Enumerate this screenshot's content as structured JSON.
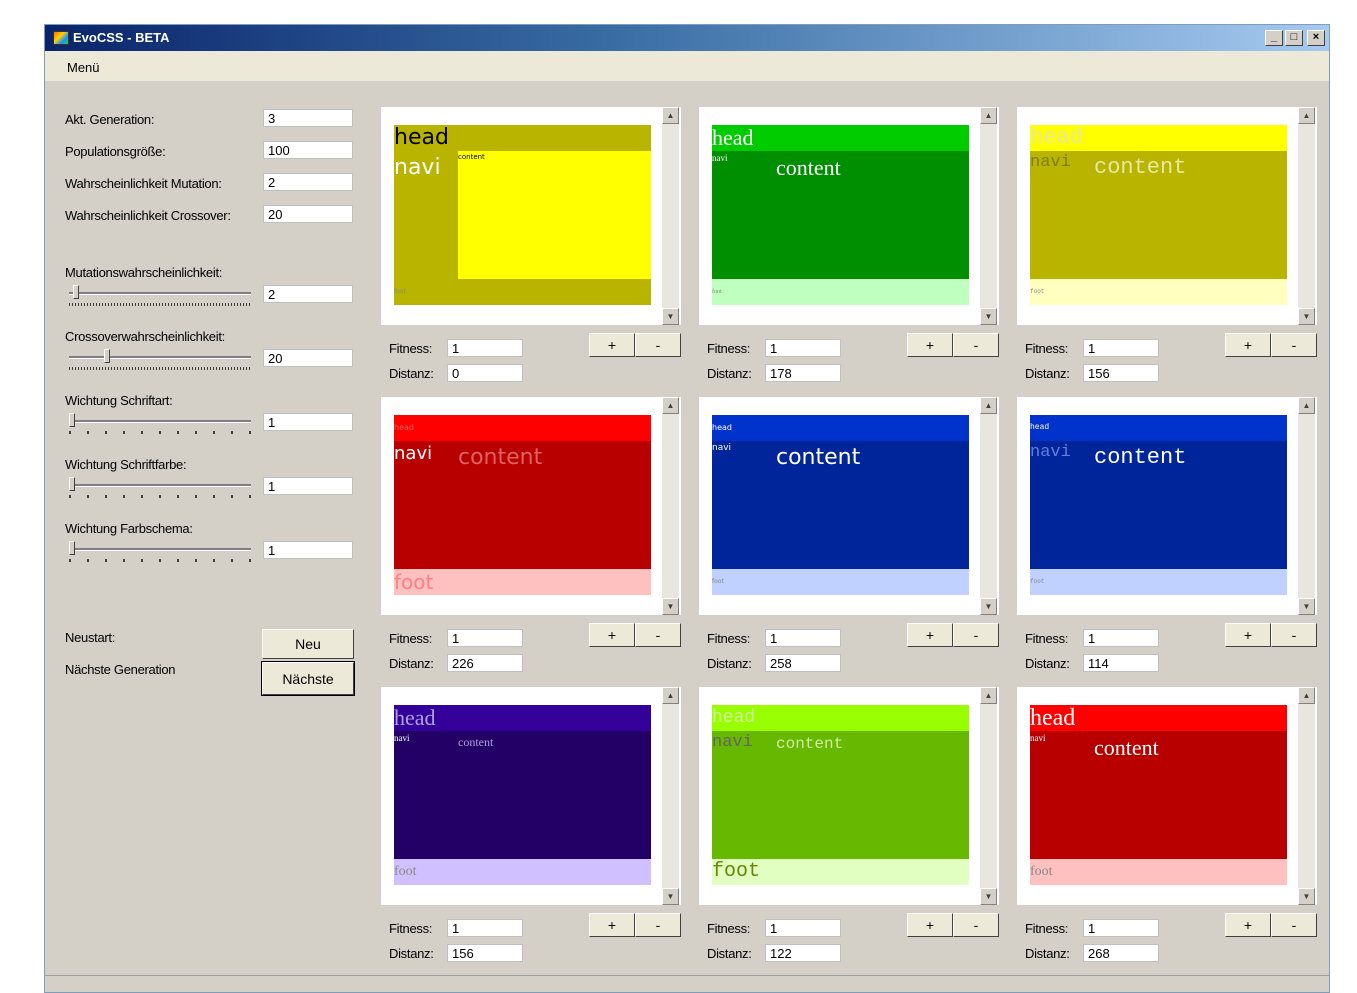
{
  "window": {
    "title": "EvoCSS - BETA",
    "controls": [
      "_",
      "□",
      "×"
    ]
  },
  "menu": {
    "items": [
      "Menü"
    ]
  },
  "left": {
    "fields": [
      {
        "label": "Akt. Generation:",
        "value": "3"
      },
      {
        "label": "Populationsgröße:",
        "value": "100"
      },
      {
        "label": "Wahrscheinlichkeit Mutation:",
        "value": "2"
      },
      {
        "label": "Wahrscheinlichkeit Crossover:",
        "value": "20"
      }
    ],
    "sliders": [
      {
        "label": "Mutationswahrscheinlichkeit:",
        "value": "2",
        "level": 0.02
      },
      {
        "label": "Crossoverwahrscheinlichkeit:",
        "value": "20",
        "level": 0.2
      },
      {
        "label": "Wichtung Schriftart:",
        "value": "1",
        "level": 0
      },
      {
        "label": "Wichtung Schriftfarbe:",
        "value": "1",
        "level": 0
      },
      {
        "label": "Wichtung Farbschema:",
        "value": "1",
        "level": 0
      }
    ],
    "neustart_label": "Neustart:",
    "next_label": "Nächste Generation",
    "neu_button": "Neu",
    "next_button": "Nächste"
  },
  "metric_labels": {
    "fitness": "Fitness:",
    "distance": "Distanz:"
  },
  "vote_buttons": {
    "plus": "+",
    "minus": "-"
  },
  "scroll_arrows": {
    "up": "▲",
    "down": "▼"
  },
  "individuals": [
    {
      "fitness": "1",
      "distance": "0",
      "colors": {
        "head": "#b8b400",
        "main": "#b8b400",
        "foot": "#b8b400",
        "inset": "#ffff00",
        "text": "#000000",
        "sub": "#ffffff"
      },
      "font": "sans",
      "labels": {
        "head": "head",
        "navi": "navi",
        "content": "content",
        "foot": "foot"
      }
    },
    {
      "fitness": "1",
      "distance": "178",
      "colors": {
        "head": "#00cc00",
        "main": "#008f00",
        "foot": "#bfffbf",
        "text": "#ffffff",
        "sub": "#ffffff"
      },
      "font": "serif",
      "labels": {
        "head": "head",
        "navi": "navi",
        "content": "content",
        "foot": "foot"
      }
    },
    {
      "fitness": "1",
      "distance": "156",
      "colors": {
        "head": "#ffff00",
        "main": "#b8b400",
        "foot": "#ffffc0",
        "text": "#e8e8a0",
        "sub": "#807c00"
      },
      "font": "mono",
      "labels": {
        "head": "head",
        "navi": "navi",
        "content": "content",
        "foot": "foot"
      }
    },
    {
      "fitness": "1",
      "distance": "226",
      "colors": {
        "head": "#ff0000",
        "main": "#b80000",
        "foot": "#ffc0c0",
        "text": "#e06060",
        "sub": "#ffffff"
      },
      "font": "sans",
      "labels": {
        "head": "head",
        "navi": "navi",
        "content": "content",
        "foot": "foot"
      }
    },
    {
      "fitness": "1",
      "distance": "258",
      "colors": {
        "head": "#0033cc",
        "main": "#00249a",
        "foot": "#c0d0ff",
        "text": "#ffffff",
        "sub": "#ffffff"
      },
      "font": "sans",
      "labels": {
        "head": "head",
        "navi": "navi",
        "content": "content",
        "foot": "foot"
      }
    },
    {
      "fitness": "1",
      "distance": "114",
      "colors": {
        "head": "#0033cc",
        "main": "#00249a",
        "foot": "#c0d0ff",
        "text": "#ffffff",
        "sub": "#6080e0"
      },
      "font": "mono",
      "labels": {
        "head": "head",
        "navi": "navi",
        "content": "content",
        "foot": "foot"
      }
    },
    {
      "fitness": "1",
      "distance": "156",
      "colors": {
        "head": "#330099",
        "main": "#220066",
        "foot": "#d0c0ff",
        "text": "#b0a0e0",
        "sub": "#ffffff"
      },
      "font": "serif",
      "labels": {
        "head": "head",
        "navi": "navi",
        "content": "content",
        "foot": "foot"
      }
    },
    {
      "fitness": "1",
      "distance": "122",
      "colors": {
        "head": "#99ff00",
        "main": "#66b800",
        "foot": "#e0ffc0",
        "text": "#d0f0a0",
        "sub": "#666666"
      },
      "font": "mono",
      "labels": {
        "head": "head",
        "navi": "navi",
        "content": "content",
        "foot": "foot"
      }
    },
    {
      "fitness": "1",
      "distance": "268",
      "colors": {
        "head": "#ff0000",
        "main": "#b80000",
        "foot": "#ffc0c0",
        "text": "#ffffff",
        "sub": "#ffffff"
      },
      "font": "serif",
      "labels": {
        "head": "head",
        "navi": "navi",
        "content": "content",
        "foot": "foot"
      }
    }
  ]
}
